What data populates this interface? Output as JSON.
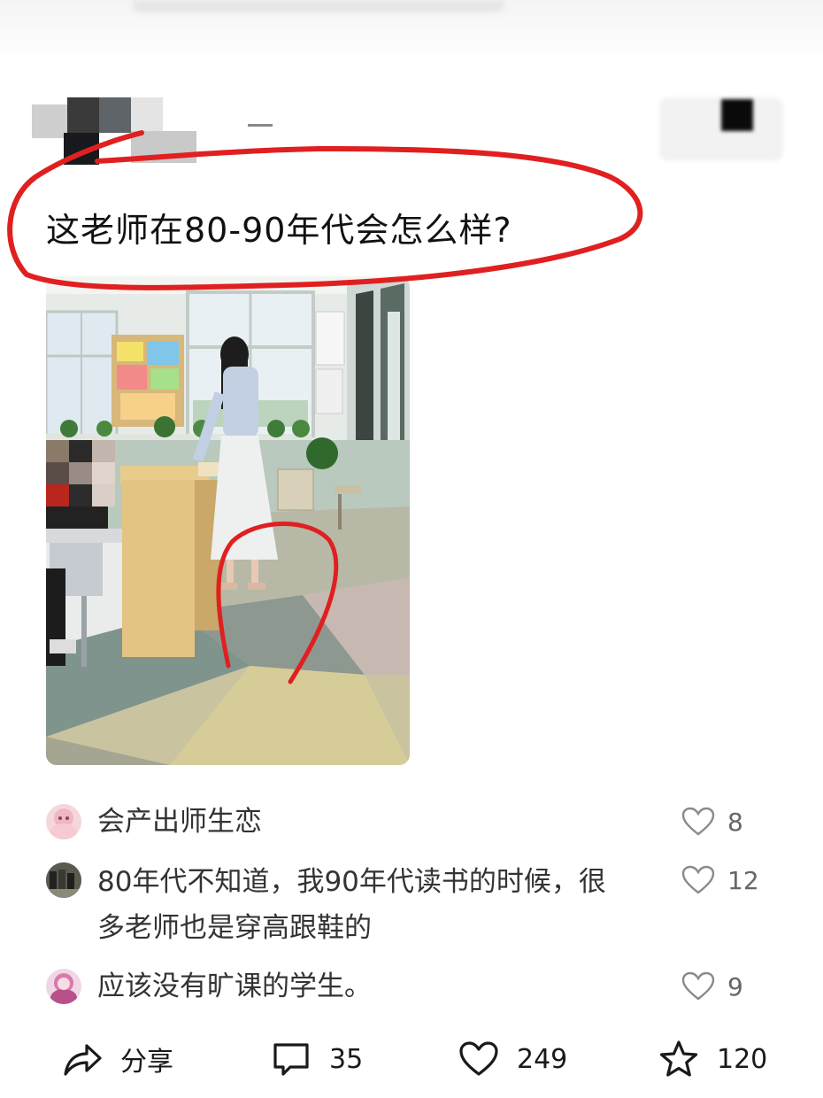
{
  "post": {
    "title": "这老师在80-90年代会怎么样?"
  },
  "comments": [
    {
      "text": "会产出师生恋",
      "likes": "8"
    },
    {
      "text": "80年代不知道，我90年代读书的时候，很多老师也是穿高跟鞋的",
      "likes": "12"
    },
    {
      "text": "应该没有旷课的学生。",
      "likes": "9"
    }
  ],
  "actions": {
    "share_label": "分享",
    "comment_count": "35",
    "like_count": "249",
    "favorite_count": "120"
  },
  "colors": {
    "annotation_red": "#e02020",
    "text": "#1a1a1a",
    "muted": "#666666"
  }
}
